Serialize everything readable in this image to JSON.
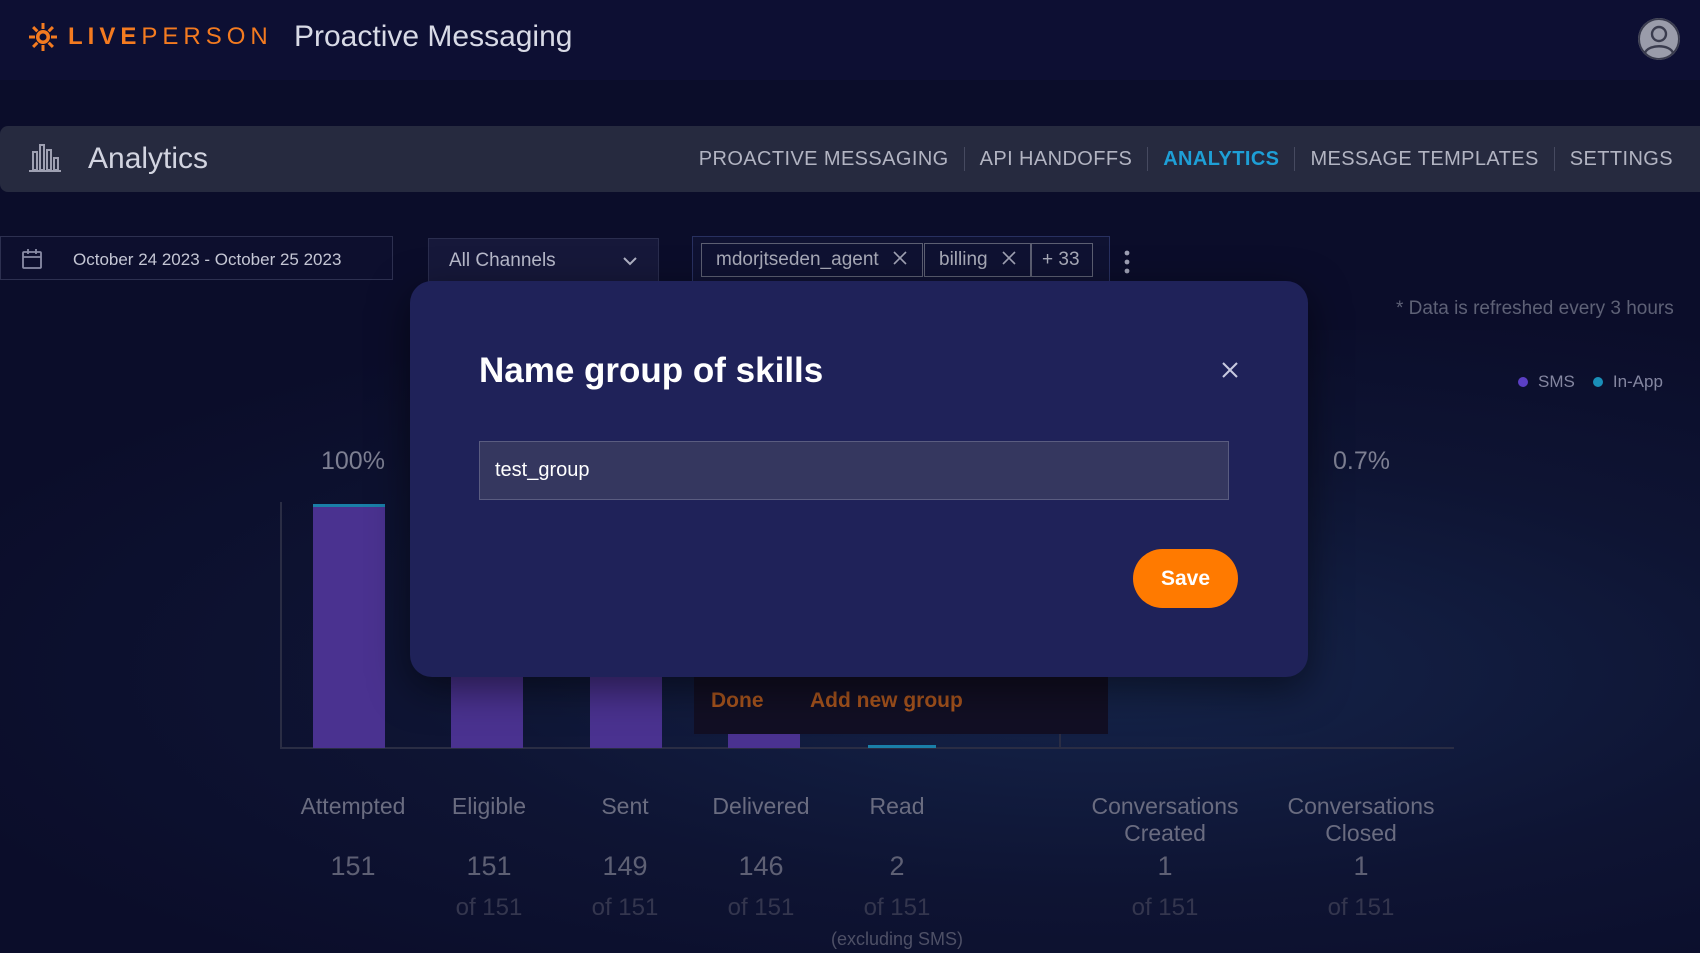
{
  "header": {
    "logo_bold": "LIVE",
    "logo_light": "PERSON",
    "app_title": "Proactive Messaging",
    "avatar_icon": "user-avatar-icon"
  },
  "nav": {
    "section_title": "Analytics",
    "section_icon": "bar-chart-icon",
    "tabs": [
      {
        "label": "PROACTIVE MESSAGING",
        "active": false
      },
      {
        "label": "API HANDOFFS",
        "active": false
      },
      {
        "label": "ANALYTICS",
        "active": true
      },
      {
        "label": "MESSAGE TEMPLATES",
        "active": false
      },
      {
        "label": "SETTINGS",
        "active": false
      }
    ]
  },
  "filters": {
    "date_range": "October 24 2023 - October 25 2023",
    "channel": "All Channels",
    "skills": [
      "mdorjtseden_agent",
      "billing"
    ],
    "more_skills": "+ 33"
  },
  "refresh_note": "* Data is refreshed every 3 hours",
  "legend": [
    {
      "name": "SMS",
      "color": "#5b3fc4"
    },
    {
      "name": "In-App",
      "color": "#1a8fb8"
    }
  ],
  "percentages": {
    "attempted": "100%",
    "conversations_closed": "0.7%"
  },
  "funnel": [
    {
      "label": "Attempted",
      "value": "151",
      "of": ""
    },
    {
      "label": "Eligible",
      "value": "151",
      "of": "of 151"
    },
    {
      "label": "Sent",
      "value": "149",
      "of": "of 151"
    },
    {
      "label": "Delivered",
      "value": "146",
      "of": "of 151"
    },
    {
      "label": "Read",
      "value": "2",
      "of": "of 151"
    },
    {
      "label": "Conversations Created",
      "value": "1",
      "of": "of 151"
    },
    {
      "label": "Conversations Closed",
      "value": "1",
      "of": "of 151"
    }
  ],
  "read_note": "(excluding SMS)",
  "dropdown_actions": {
    "done": "Done",
    "add_new_group": "Add new group"
  },
  "modal": {
    "title": "Name group of skills",
    "input_value": "test_group",
    "save_label": "Save"
  },
  "colors": {
    "accent": "#ff7a00",
    "active_tab": "#1e9fd6",
    "bar": "#4a3290"
  }
}
